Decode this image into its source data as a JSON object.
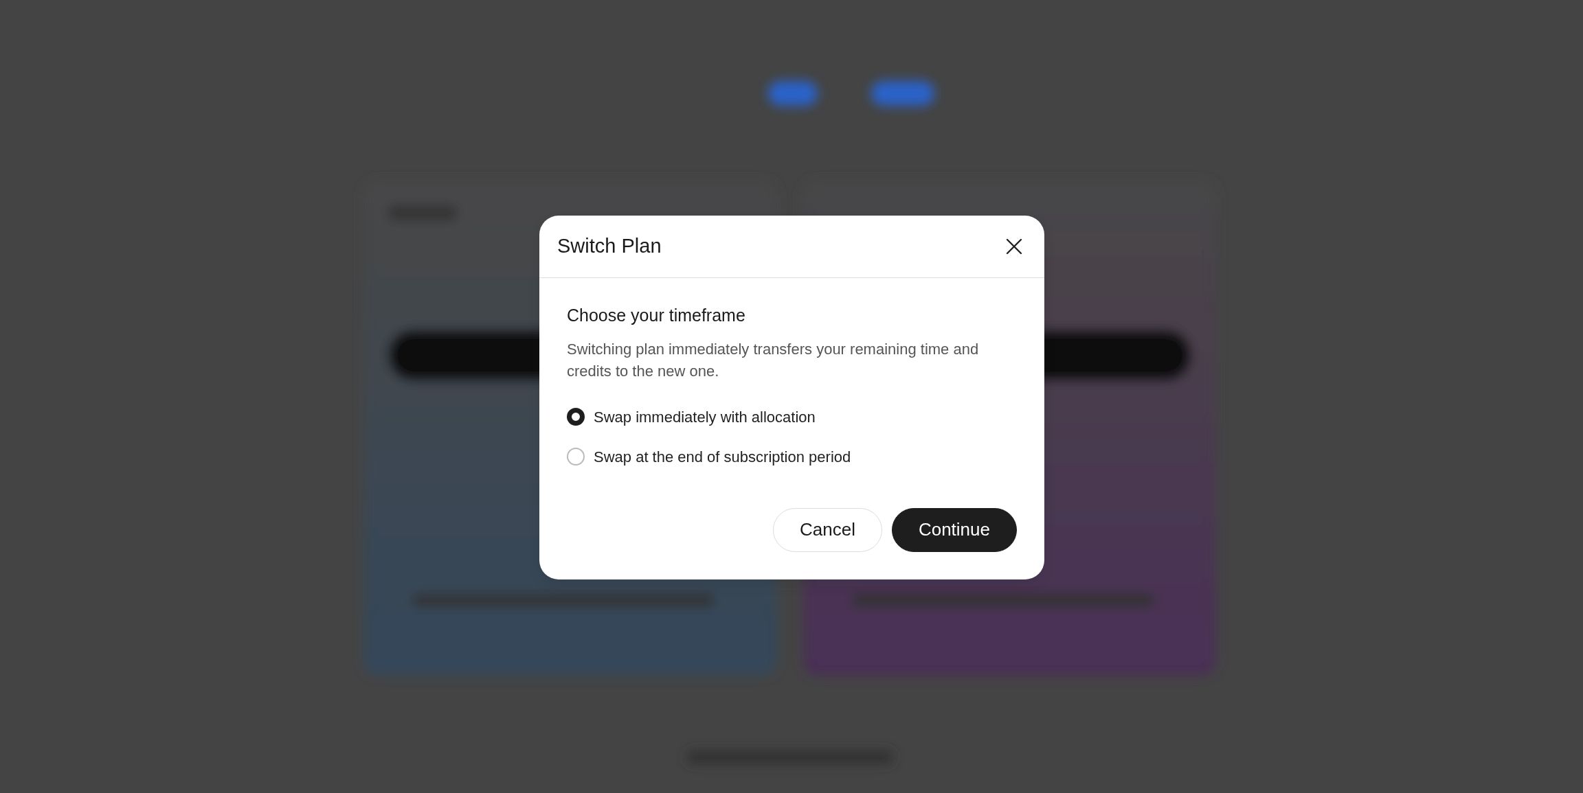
{
  "dialog": {
    "title": "Switch Plan",
    "heading": "Choose your timeframe",
    "description": "Switching plan immediately transfers your remaining time and credits to the new one.",
    "options": [
      {
        "label": "Swap immediately with allocation",
        "selected": true
      },
      {
        "label": "Swap at the end of subscription period",
        "selected": false
      }
    ],
    "buttons": [
      {
        "label": "Cancel",
        "kind": "secondary"
      },
      {
        "label": "Continue",
        "kind": "primary"
      }
    ]
  }
}
